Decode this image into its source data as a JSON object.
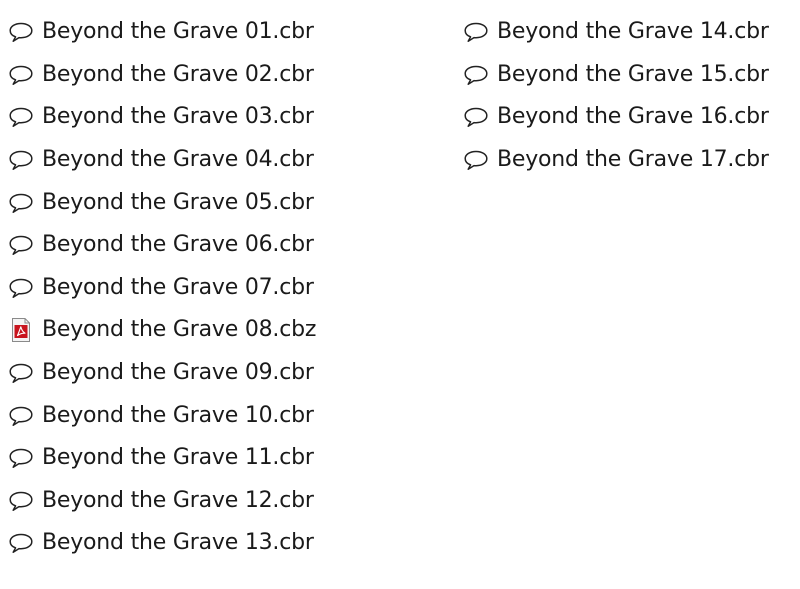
{
  "files": [
    {
      "name": "Beyond the Grave 01.cbr",
      "icon": "speech-bubble-icon"
    },
    {
      "name": "Beyond the Grave 02.cbr",
      "icon": "speech-bubble-icon"
    },
    {
      "name": "Beyond the Grave 03.cbr",
      "icon": "speech-bubble-icon"
    },
    {
      "name": "Beyond the Grave 04.cbr",
      "icon": "speech-bubble-icon"
    },
    {
      "name": "Beyond the Grave 05.cbr",
      "icon": "speech-bubble-icon"
    },
    {
      "name": "Beyond the Grave 06.cbr",
      "icon": "speech-bubble-icon"
    },
    {
      "name": "Beyond the Grave 07.cbr",
      "icon": "speech-bubble-icon"
    },
    {
      "name": "Beyond the Grave 08.cbz",
      "icon": "pdf-document-icon"
    },
    {
      "name": "Beyond the Grave 09.cbr",
      "icon": "speech-bubble-icon"
    },
    {
      "name": "Beyond the Grave 10.cbr",
      "icon": "speech-bubble-icon"
    },
    {
      "name": "Beyond the Grave 11.cbr",
      "icon": "speech-bubble-icon"
    },
    {
      "name": "Beyond the Grave 12.cbr",
      "icon": "speech-bubble-icon"
    },
    {
      "name": "Beyond the Grave 13.cbr",
      "icon": "speech-bubble-icon"
    },
    {
      "name": "Beyond the Grave 14.cbr",
      "icon": "speech-bubble-icon"
    },
    {
      "name": "Beyond the Grave 15.cbr",
      "icon": "speech-bubble-icon"
    },
    {
      "name": "Beyond the Grave 16.cbr",
      "icon": "speech-bubble-icon"
    },
    {
      "name": "Beyond the Grave 17.cbr",
      "icon": "speech-bubble-icon"
    }
  ],
  "colors": {
    "text": "#1a1a1a",
    "icon_stroke": "#222222",
    "pdf_red": "#c8141e",
    "pdf_page": "#f4f4f4"
  }
}
